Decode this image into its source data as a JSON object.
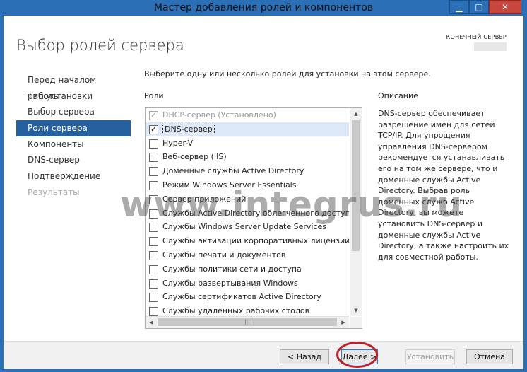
{
  "window": {
    "title": "Мастер добавления ролей и компонентов",
    "controls": {
      "minimize": "▁",
      "maximize": "□",
      "close": "✕"
    }
  },
  "header": {
    "page_title": "Выбор ролей сервера",
    "server_label": "КОНЕЧНЫЙ СЕРВЕР"
  },
  "nav": {
    "items": [
      {
        "label": "Перед началом работы",
        "state": "normal"
      },
      {
        "label": "Тип установки",
        "state": "normal"
      },
      {
        "label": "Выбор сервера",
        "state": "normal"
      },
      {
        "label": "Роли сервера",
        "state": "active"
      },
      {
        "label": "Компоненты",
        "state": "normal"
      },
      {
        "label": "DNS-сервер",
        "state": "normal"
      },
      {
        "label": "Подтверждение",
        "state": "normal"
      },
      {
        "label": "Результаты",
        "state": "disabled"
      }
    ]
  },
  "main": {
    "instruction": "Выберите одну или несколько ролей для установки на этом сервере.",
    "roles_label": "Роли",
    "roles": [
      {
        "label": "DHCP-сервер (Установлено)",
        "checked": true,
        "disabled": true
      },
      {
        "label": "DNS-сервер",
        "checked": true,
        "selected": true
      },
      {
        "label": "Hyper-V",
        "checked": false
      },
      {
        "label": "Веб-сервер (IIS)",
        "checked": false
      },
      {
        "label": "Доменные службы Active Directory",
        "checked": false
      },
      {
        "label": "Режим Windows Server Essentials",
        "checked": false
      },
      {
        "label": "Сервер приложений",
        "checked": false
      },
      {
        "label": "Службы Active Directory облегченного доступа к",
        "checked": false
      },
      {
        "label": "Службы Windows Server Update Services",
        "checked": false
      },
      {
        "label": "Службы активации корпоративных лицензий",
        "checked": false
      },
      {
        "label": "Службы печати и документов",
        "checked": false
      },
      {
        "label": "Службы политики сети и доступа",
        "checked": false
      },
      {
        "label": "Службы развертывания Windows",
        "checked": false
      },
      {
        "label": "Службы сертификатов Active Directory",
        "checked": false
      },
      {
        "label": "Службы удаленных рабочих столов",
        "checked": false
      }
    ],
    "check_glyph": "✓",
    "scroll": {
      "up": "▲",
      "down": "▼",
      "left": "◀",
      "right": "▶",
      "grip": "|||"
    }
  },
  "description": {
    "label": "Описание",
    "text": "DNS-сервер обеспечивает разрешение имен для сетей TCP/IP. Для упрощения управления DNS-сервером рекомендуется устанавливать его на том же сервере, что и доменные службы Active Directory. Выбрав роль доменных служб Active Directory, вы можете установить DNS-сервер и доменные службы Active Directory, а также настроить их для совместной работы."
  },
  "footer": {
    "prev_label": "< Назад",
    "next_label": "Далее >",
    "install_label": "Установить",
    "cancel_label": "Отмена"
  },
  "watermark": "www.integrus.ru"
}
